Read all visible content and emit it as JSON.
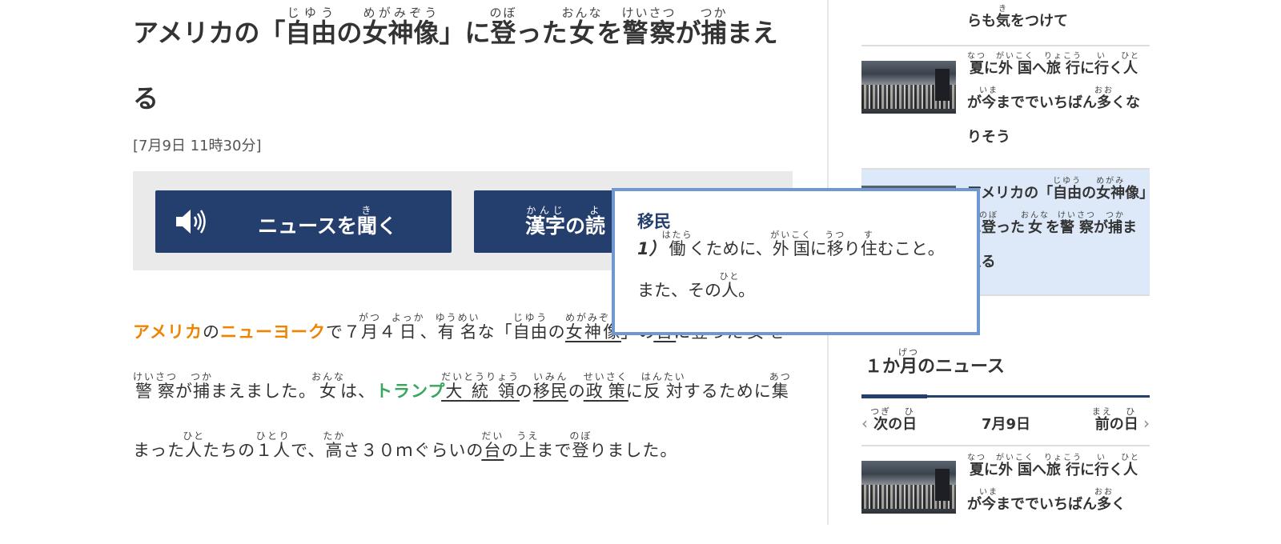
{
  "article": {
    "title": [
      {
        "rb": "アメリカの「",
        "rt": ""
      },
      {
        "rb": "自由",
        "rt": "じゆう"
      },
      {
        "rb": "の",
        "rt": ""
      },
      {
        "rb": "女神像",
        "rt": "めがみぞう"
      },
      {
        "rb": "」に",
        "rt": ""
      },
      {
        "rb": "登",
        "rt": "のぼ"
      },
      {
        "rb": "った",
        "rt": ""
      },
      {
        "rb": "女",
        "rt": "おんな"
      },
      {
        "rb": "を",
        "rt": ""
      },
      {
        "rb": "警察",
        "rt": "けいさつ"
      },
      {
        "rb": "が",
        "rt": ""
      },
      {
        "rb": "捕",
        "rt": "つか"
      },
      {
        "rb": "まえる",
        "rt": ""
      }
    ],
    "date": "[7月9日 11時30分]",
    "buttons": {
      "listen": [
        {
          "rb": "ニュースを",
          "rt": ""
        },
        {
          "rb": "聞",
          "rt": "き"
        },
        {
          "rb": "く",
          "rt": ""
        }
      ],
      "kanji": [
        {
          "rb": "漢字",
          "rt": "かんじ"
        },
        {
          "rb": "の",
          "rt": ""
        },
        {
          "rb": "読",
          "rt": "よ"
        }
      ]
    },
    "body": [
      {
        "rb": "アメリカ",
        "rt": "",
        "cls": "place"
      },
      {
        "rb": "の",
        "rt": ""
      },
      {
        "rb": "ニューヨーク",
        "rt": "",
        "cls": "place"
      },
      {
        "rb": "で７",
        "rt": ""
      },
      {
        "rb": "月",
        "rt": "がつ"
      },
      {
        "rb": "４",
        "rt": ""
      },
      {
        "rb": "日",
        "rt": "よっか"
      },
      {
        "rb": "、",
        "rt": ""
      },
      {
        "rb": "有名",
        "rt": "ゆうめい"
      },
      {
        "rb": "な「",
        "rt": ""
      },
      {
        "rb": "自由",
        "rt": "じゆう"
      },
      {
        "rb": "の",
        "rt": ""
      },
      {
        "rb": "女神像",
        "rt": "めがみぞう",
        "cls": "dict"
      },
      {
        "rb": "」の",
        "rt": ""
      },
      {
        "rb": "台",
        "rt": "だい",
        "cls": "dict"
      },
      {
        "rb": "に",
        "rt": ""
      },
      {
        "rb": "登",
        "rt": "のぼ"
      },
      {
        "rb": "った",
        "rt": ""
      },
      {
        "rb": "女",
        "rt": "おんな"
      },
      {
        "rb": "を",
        "rt": ""
      },
      {
        "rb": "警察",
        "rt": "けいさつ"
      },
      {
        "rb": "が",
        "rt": ""
      },
      {
        "rb": "捕",
        "rt": "つか"
      },
      {
        "rb": "まえました。",
        "rt": ""
      },
      {
        "rb": "女",
        "rt": "おんな"
      },
      {
        "rb": "は、",
        "rt": ""
      },
      {
        "rb": "トランプ",
        "rt": "",
        "cls": "person"
      },
      {
        "rb": "大統領",
        "rt": "だいとうりょう",
        "cls": "dict"
      },
      {
        "rb": "の",
        "rt": ""
      },
      {
        "rb": "移民",
        "rt": "いみん",
        "cls": "dict"
      },
      {
        "rb": "の",
        "rt": ""
      },
      {
        "rb": "政策",
        "rt": "せいさく",
        "cls": "dict"
      },
      {
        "rb": "に",
        "rt": ""
      },
      {
        "rb": "反対",
        "rt": "はんたい"
      },
      {
        "rb": "するために",
        "rt": ""
      },
      {
        "rb": "集",
        "rt": "あつ"
      },
      {
        "rb": "まった",
        "rt": ""
      },
      {
        "rb": "人",
        "rt": "ひと"
      },
      {
        "rb": "たちの",
        "rt": ""
      },
      {
        "rb": "１人",
        "rt": "ひとり"
      },
      {
        "rb": "で、",
        "rt": ""
      },
      {
        "rb": "高",
        "rt": "たか"
      },
      {
        "rb": "さ３０ｍぐらいの",
        "rt": ""
      },
      {
        "rb": "台",
        "rt": "だい",
        "cls": "dict"
      },
      {
        "rb": "の",
        "rt": ""
      },
      {
        "rb": "上",
        "rt": "うえ"
      },
      {
        "rb": "まで",
        "rt": ""
      },
      {
        "rb": "登",
        "rt": "のぼ"
      },
      {
        "rb": "りました。",
        "rt": ""
      }
    ]
  },
  "popup": {
    "word": "移民",
    "number": "1）",
    "definition": [
      {
        "rb": "働",
        "rt": "はたら"
      },
      {
        "rb": "くために、",
        "rt": ""
      },
      {
        "rb": "外国",
        "rt": "がいこく"
      },
      {
        "rb": "に",
        "rt": ""
      },
      {
        "rb": "移",
        "rt": "うつ"
      },
      {
        "rb": "り",
        "rt": ""
      },
      {
        "rb": "住",
        "rt": "す"
      },
      {
        "rb": "むこと。また、その",
        "rt": ""
      },
      {
        "rb": "人",
        "rt": "ひと"
      },
      {
        "rb": "。",
        "rt": ""
      }
    ]
  },
  "sidebar": {
    "items": [
      {
        "title": [
          {
            "rb": "らも",
            "rt": ""
          },
          {
            "rb": "気",
            "rt": "き"
          },
          {
            "rb": "をつけて",
            "rt": ""
          }
        ],
        "has_thumb": false
      },
      {
        "title": [
          {
            "rb": "夏",
            "rt": "なつ"
          },
          {
            "rb": "に",
            "rt": ""
          },
          {
            "rb": "外国",
            "rt": "がいこく"
          },
          {
            "rb": "へ",
            "rt": ""
          },
          {
            "rb": "旅行",
            "rt": "りょこう"
          },
          {
            "rb": "に",
            "rt": ""
          },
          {
            "rb": "行",
            "rt": "い"
          },
          {
            "rb": "く",
            "rt": ""
          },
          {
            "rb": "人",
            "rt": "ひと"
          },
          {
            "rb": "が",
            "rt": ""
          },
          {
            "rb": "今",
            "rt": "いま"
          },
          {
            "rb": "まででいちばん",
            "rt": ""
          },
          {
            "rb": "多",
            "rt": "おお"
          },
          {
            "rb": "くなりそう",
            "rt": ""
          }
        ],
        "has_thumb": true
      },
      {
        "title": [
          {
            "rb": "アメリカの「",
            "rt": ""
          },
          {
            "rb": "自由",
            "rt": "じゆう"
          },
          {
            "rb": "の",
            "rt": ""
          },
          {
            "rb": "女神",
            "rt": "めがみ"
          },
          {
            "rb": "像」に",
            "rt": ""
          },
          {
            "rb": "登",
            "rt": "のぼ"
          },
          {
            "rb": "った",
            "rt": ""
          },
          {
            "rb": "女",
            "rt": "おんな"
          },
          {
            "rb": "を",
            "rt": ""
          },
          {
            "rb": "警察",
            "rt": "けいさつ"
          },
          {
            "rb": "が",
            "rt": ""
          },
          {
            "rb": "捕",
            "rt": "つか"
          },
          {
            "rb": "まえる",
            "rt": ""
          }
        ],
        "has_thumb": true,
        "active": true
      },
      {
        "title": [
          {
            "rb": "夏",
            "rt": "なつ"
          },
          {
            "rb": "に",
            "rt": ""
          },
          {
            "rb": "外国",
            "rt": "がいこく"
          },
          {
            "rb": "へ",
            "rt": ""
          },
          {
            "rb": "旅行",
            "rt": "りょこう"
          },
          {
            "rb": "に",
            "rt": ""
          },
          {
            "rb": "行",
            "rt": "い"
          },
          {
            "rb": "く",
            "rt": ""
          },
          {
            "rb": "人",
            "rt": "ひと"
          },
          {
            "rb": "が",
            "rt": ""
          },
          {
            "rb": "今",
            "rt": "いま"
          },
          {
            "rb": "まででいちばん",
            "rt": ""
          },
          {
            "rb": "多",
            "rt": "おお"
          },
          {
            "rb": "く",
            "rt": ""
          }
        ],
        "has_thumb": true
      }
    ],
    "month_heading": [
      {
        "rb": "１か",
        "rt": ""
      },
      {
        "rb": "月",
        "rt": "げつ"
      },
      {
        "rb": "のニュース",
        "rt": ""
      }
    ],
    "daynav": {
      "prev": [
        {
          "rb": "次",
          "rt": "つぎ"
        },
        {
          "rb": "の",
          "rt": ""
        },
        {
          "rb": "日",
          "rt": "ひ"
        }
      ],
      "today": "7月9日",
      "next": [
        {
          "rb": "前",
          "rt": "まえ"
        },
        {
          "rb": "の",
          "rt": ""
        },
        {
          "rb": "日",
          "rt": "ひ"
        }
      ],
      "prev_icon": "‹",
      "next_icon": "›"
    }
  },
  "colors": {
    "accent": "#243f6e",
    "place": "#f08300",
    "person": "#3aa55e",
    "popup_border": "#6f98d0",
    "active_item": "#dde9f9"
  }
}
